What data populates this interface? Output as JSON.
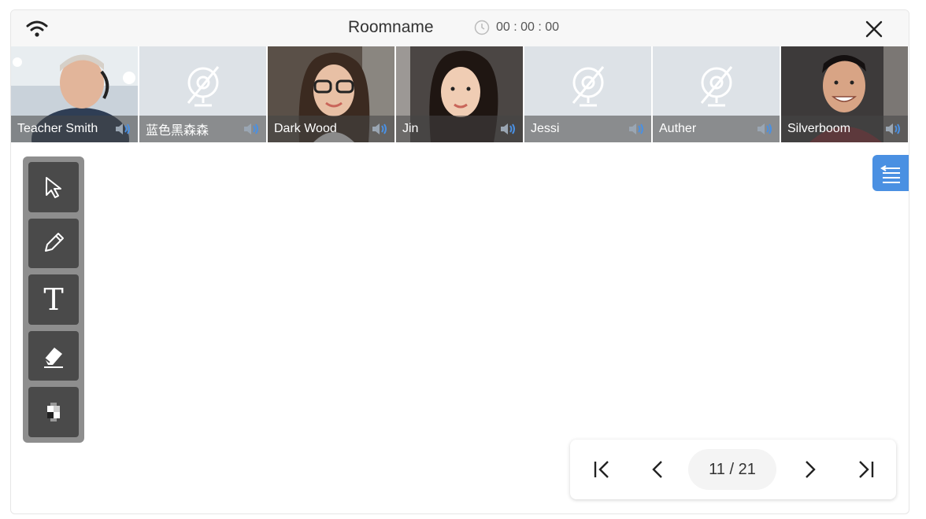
{
  "header": {
    "room_name": "Roomname",
    "timer": "00 : 00 : 00"
  },
  "participants": [
    {
      "name": "Teacher Smith",
      "video": "on"
    },
    {
      "name": "蓝色黑森森",
      "video": "off"
    },
    {
      "name": "Dark Wood",
      "video": "on"
    },
    {
      "name": "Jin",
      "video": "on"
    },
    {
      "name": "Jessi",
      "video": "off"
    },
    {
      "name": "Auther",
      "video": "off"
    },
    {
      "name": "Silverboom",
      "video": "on"
    }
  ],
  "tools": [
    "select-tool",
    "pencil-tool",
    "text-tool",
    "eraser-tool",
    "mosaic-tool"
  ],
  "text_tool_glyph": "T",
  "pagination": {
    "current": "11 / 21"
  },
  "colors": {
    "accent": "#4a90e2",
    "toolbar_bg": "#8e8e8e",
    "tool_bg": "#4a4a4a"
  }
}
